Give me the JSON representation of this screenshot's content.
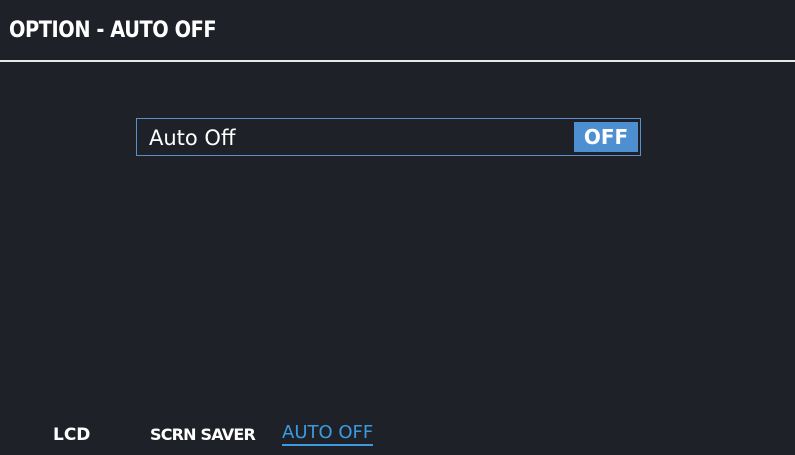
{
  "header": {
    "title": "OPTION - AUTO OFF"
  },
  "params": [
    {
      "label": "Auto Off",
      "value": "OFF"
    }
  ],
  "tabs": [
    {
      "label": "LCD",
      "selected": false
    },
    {
      "label": "SCRN SAVER",
      "selected": false
    },
    {
      "label": "AUTO OFF",
      "selected": true
    }
  ],
  "colors": {
    "background": "#1e2127",
    "accent": "#4d8fd1",
    "selected_tab": "#3d9ae0",
    "row_border": "#5b8fc9"
  }
}
